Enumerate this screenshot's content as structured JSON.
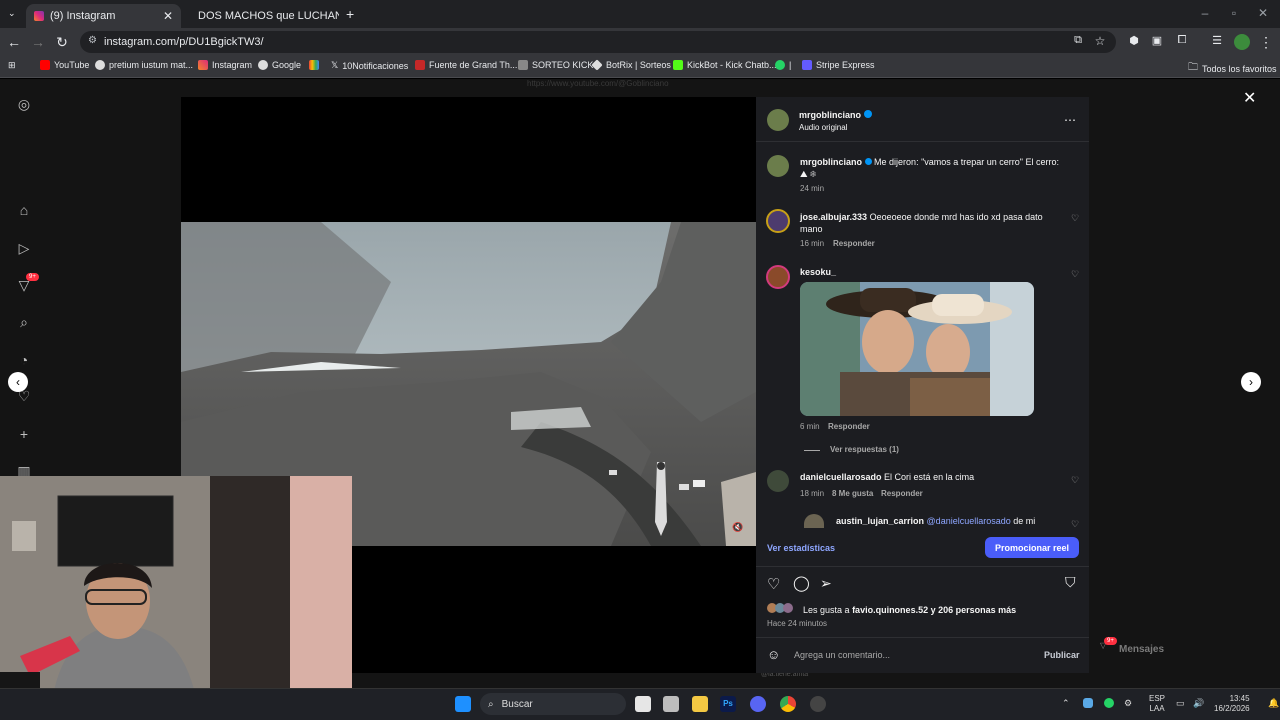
{
  "browser": {
    "tabs": [
      {
        "label": "(9) Instagram",
        "icon": "instagram-icon"
      },
      {
        "label": "DOS MACHOS que LUCHAN p",
        "icon": "youtube-icon"
      }
    ],
    "url": "instagram.com/p/DU1BgickTW3/",
    "bookmarks": [
      "YouTube",
      "pretium iustum mat...",
      "Instagram",
      "Google",
      "10Notificaciones",
      "Fuente de Grand Th...",
      "SORTEO KICK",
      "BotRix | Sorteos",
      "KickBot - Kick Chatb...",
      "Stripe Express"
    ],
    "bookmark_sep": "|",
    "all_bookmarks": "Todos los favoritos"
  },
  "sidebar": {
    "badge": "9+"
  },
  "video": {
    "top_text": "https://www.youtube.com/@Goblinciano",
    "bottom_credit": "@la.tiene.afrita"
  },
  "post": {
    "author": "mrgoblinciano",
    "audio": "Audio original",
    "caption_user": "mrgoblinciano",
    "caption": "Me dijeron: \"vamos a trepar un cerro\" El cerro:",
    "caption_emojis": "⛰ ❄",
    "caption_time": "24 min",
    "comments": [
      {
        "user": "jose.albujar.333",
        "text": "Oeoeoeoe donde mrd has ido xd pasa dato mano",
        "time": "16 min",
        "reply": "Responder"
      },
      {
        "user": "kesoku_",
        "text": "",
        "time": "6 min",
        "reply": "Responder",
        "view_replies": "Ver respuestas (1)"
      },
      {
        "user": "danielcuellarosado",
        "text": "El Cori está en la cima",
        "time": "18 min",
        "likes": "8 Me gusta",
        "reply": "Responder"
      },
      {
        "user": "austin_lujan_carrion",
        "mention": "@danielcuellarosado",
        "text": "de mi"
      }
    ],
    "stats_link": "Ver estadísticas",
    "promote": "Promocionar reel",
    "likes_prefix": "Les gusta a",
    "likes_user": "favio.quinones.52",
    "likes_suffix": "y 206 personas más",
    "posted": "Hace 24 minutos",
    "comment_placeholder": "Agrega un comentario...",
    "publish": "Publicar"
  },
  "messages": {
    "label": "Mensajes",
    "badge": "9+"
  },
  "taskbar": {
    "search": "Buscar",
    "lang1": "ESP",
    "lang2": "LAA",
    "time": "13:45",
    "date": "16/2/2026"
  },
  "colors": {
    "accent": "#4a5df9",
    "verified": "#0095f6",
    "chrome_bg": "#202124"
  }
}
